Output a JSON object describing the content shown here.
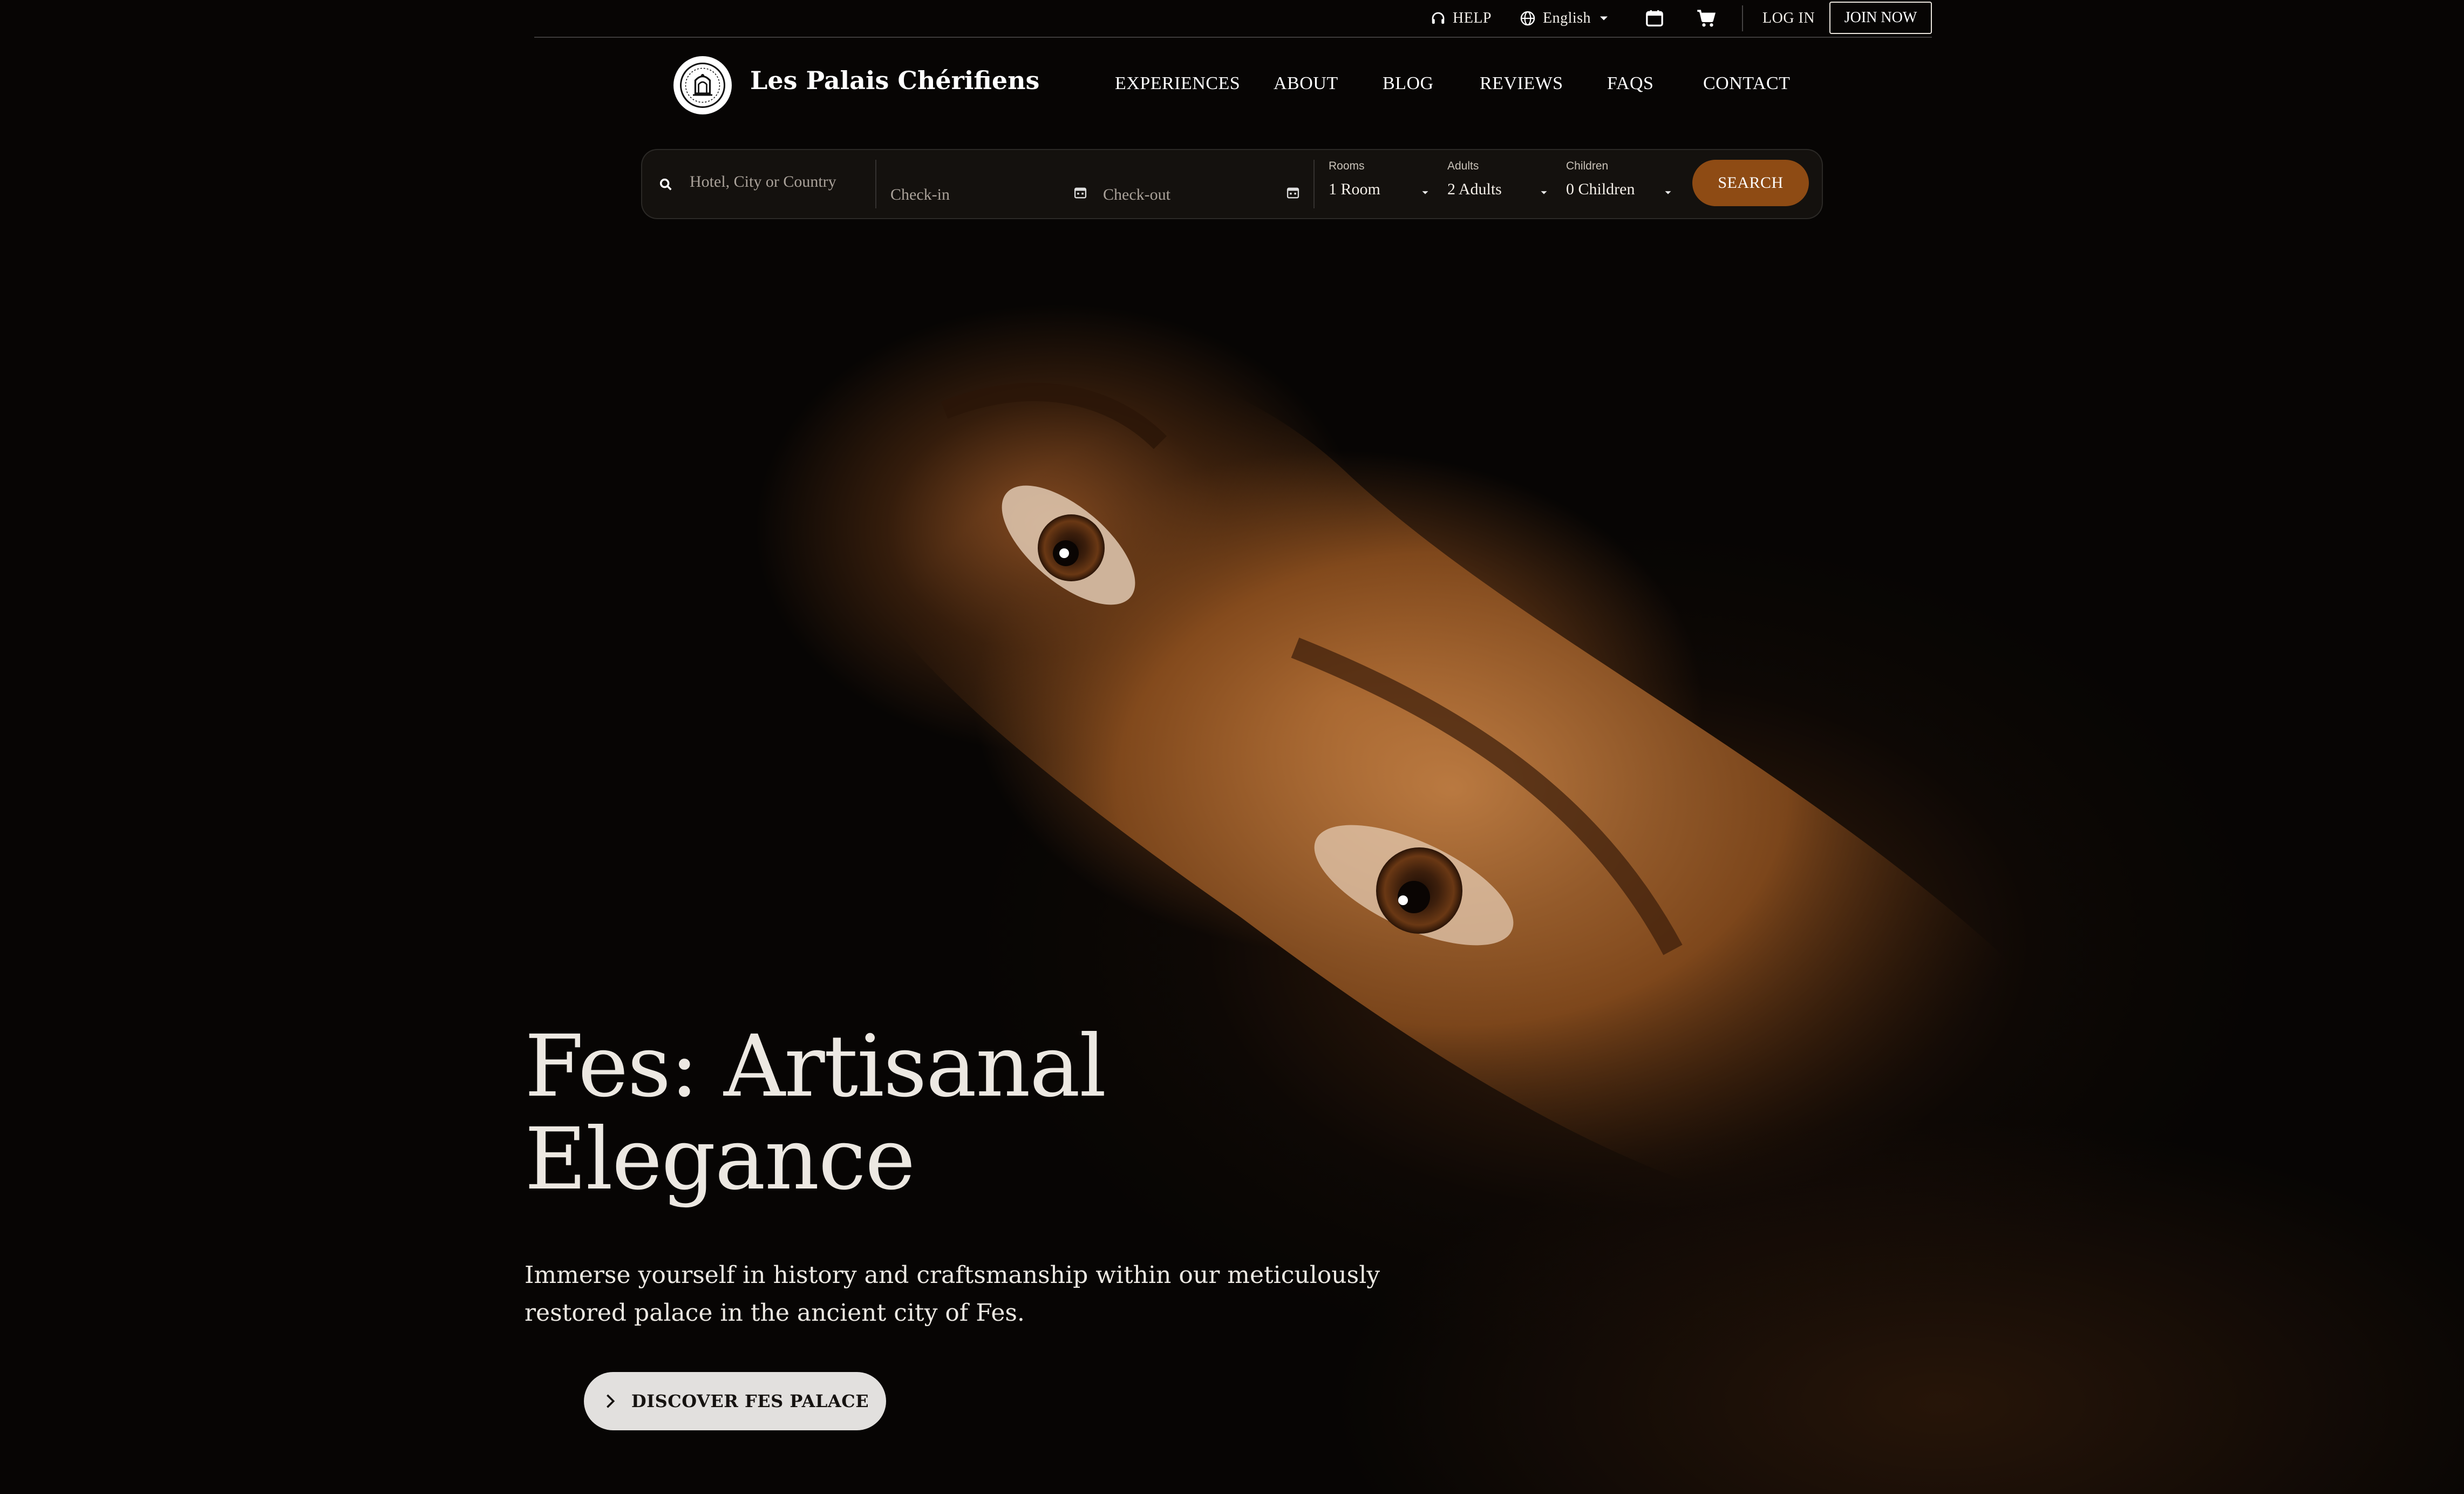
{
  "brand": {
    "name": "Les Palais Chérifiens",
    "logo_icon": "palace-crest-icon"
  },
  "utility": {
    "help": "HELP",
    "language": "English",
    "login": "LOG IN",
    "join": "JOIN NOW",
    "icons": [
      "headset-icon",
      "globe-icon",
      "chevron-down-icon",
      "calendar-icon",
      "cart-icon"
    ]
  },
  "nav": {
    "items": [
      {
        "label": "EXPERIENCES"
      },
      {
        "label": "ABOUT"
      },
      {
        "label": "BLOG"
      },
      {
        "label": "REVIEWS"
      },
      {
        "label": "FAQS"
      },
      {
        "label": "CONTACT"
      }
    ]
  },
  "search": {
    "destination_placeholder": "Hotel, City or Country",
    "checkin_placeholder": "Check-in",
    "checkout_placeholder": "Check-out",
    "rooms_label": "Rooms",
    "rooms_value": "1 Room",
    "adults_label": "Adults",
    "adults_value": "2 Adults",
    "children_label": "Children",
    "children_value": "0 Children",
    "button": "SEARCH"
  },
  "hero": {
    "title_line1": "Fes: Artisanal",
    "title_line2": "Elegance",
    "subtitle": "Immerse yourself in history and craftsmanship within our meticulously restored palace in the ancient city of Fes.",
    "cta": "DISCOVER FES PALACE"
  },
  "colors": {
    "accent": "#8e4b14",
    "background": "#070504",
    "cta_bg": "#e2e0de"
  }
}
